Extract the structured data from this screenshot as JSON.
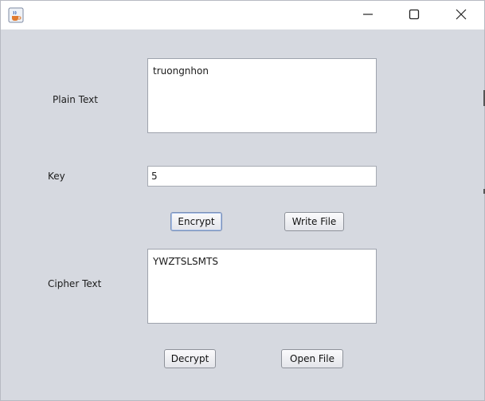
{
  "window": {
    "icons": {
      "app": "java-cup-icon",
      "minimize": "minimize-icon",
      "maximize": "maximize-icon",
      "close": "close-icon"
    }
  },
  "form": {
    "plain_text_label": "Plain Text",
    "plain_text_value": "truongnhon",
    "key_label": "Key",
    "key_value": "5",
    "cipher_text_label": "Cipher Text",
    "cipher_text_value": "YWZTSLSMTS"
  },
  "buttons": {
    "encrypt": "Encrypt",
    "write_file": "Write File",
    "decrypt": "Decrypt",
    "open_file": "Open File"
  },
  "colors": {
    "background": "#d6d9e0",
    "titlebar": "#ffffff",
    "focus_ring": "#a9c1ea"
  }
}
